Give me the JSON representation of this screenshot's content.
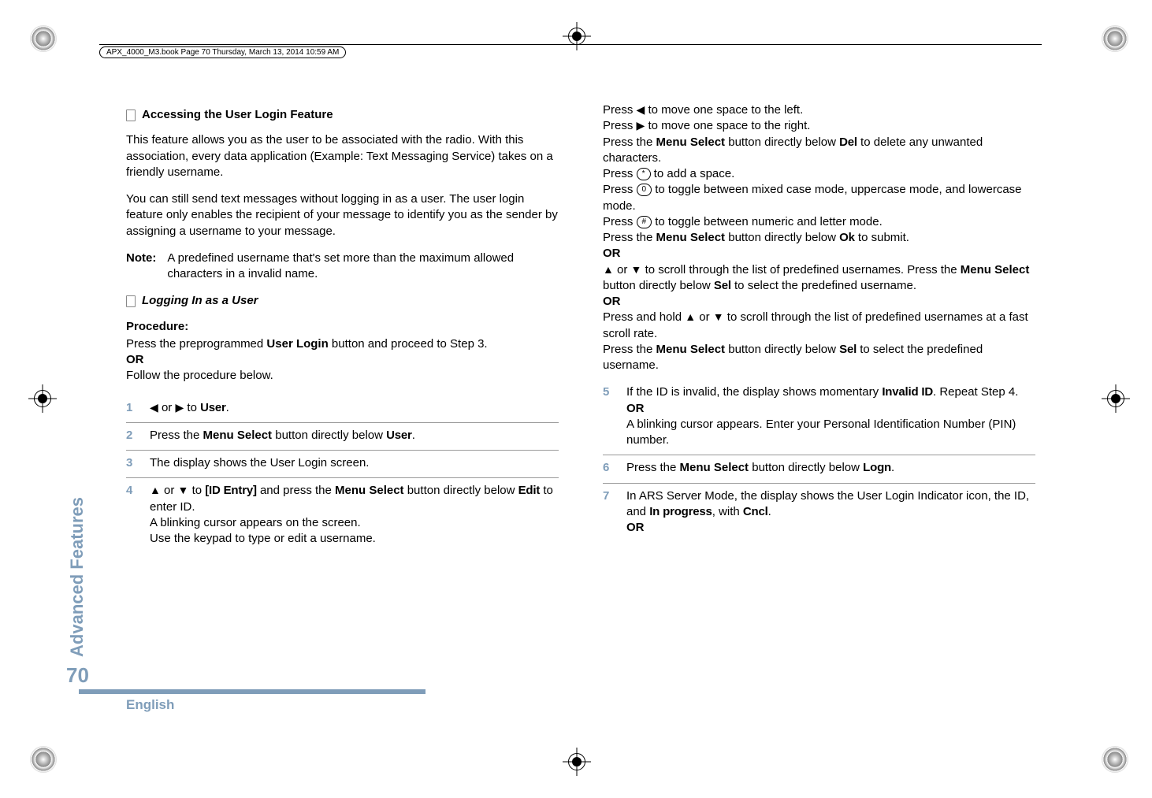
{
  "header": {
    "running": "APX_4000_M3.book  Page 70  Thursday, March 13, 2014  10:59 AM"
  },
  "sidebar": {
    "section": "Advanced Features",
    "page": "70"
  },
  "footer": {
    "language": "English"
  },
  "left": {
    "heading1": "Accessing the User Login Feature",
    "p1": "This feature allows you as the user to be associated with the radio. With this association, every data application (Example: Text Messaging Service) takes on a friendly username.",
    "p2": "You can still send text messages without logging in as a user. The user login feature only enables the recipient of your message to identify you as the sender by assigning a username to your message.",
    "note_label": "Note:",
    "note_body": "A predefined username that's set more than the maximum allowed characters in a invalid name.",
    "heading2": "Logging In as a User",
    "proc_label": "Procedure:",
    "proc_intro1a": "Press the preprogrammed ",
    "proc_intro1b": "User Login",
    "proc_intro1c": " button and proceed to Step 3.",
    "or": "OR",
    "proc_intro2": "Follow the procedure below.",
    "steps": {
      "s1": {
        "num": "1",
        "a": " or ",
        "b": " to ",
        "ui": "User",
        "c": "."
      },
      "s2": {
        "num": "2",
        "a": "Press the ",
        "b": "Menu Select",
        "c": " button directly below ",
        "ui": "User",
        "d": "."
      },
      "s3": {
        "num": "3",
        "a": "The display shows the User Login screen."
      },
      "s4": {
        "num": "4",
        "a": " or ",
        "b": " to ",
        "ui1": "[ID Entry]",
        "c": " and press the ",
        "d": "Menu Select",
        "e": " button directly below ",
        "ui2": "Edit",
        "f": " to enter ID.",
        "g": "A blinking cursor appears on the screen.",
        "h": "Use the keypad to type or edit a username."
      }
    }
  },
  "right": {
    "l1a": "Press ",
    "l1b": " to move one space to the left.",
    "l2a": "Press ",
    "l2b": " to move one space to the right.",
    "l3a": "Press the ",
    "l3b": "Menu Select",
    "l3c": " button directly below ",
    "l3ui": "Del",
    "l3d": " to delete any unwanted characters.",
    "l4a": "Press ",
    "l4key": "*",
    "l4b": " to add a space.",
    "l5a": "Press ",
    "l5key": "0",
    "l5b": " to toggle between mixed case mode, uppercase mode, and lowercase mode.",
    "l6a": "Press ",
    "l6key": "#",
    "l6b": " to toggle between numeric and letter mode.",
    "l7a": "Press the ",
    "l7b": "Menu Select",
    "l7c": " button directly below ",
    "l7ui": "Ok",
    "l7d": " to submit.",
    "or": "OR",
    "l8a": " or ",
    "l8b": " to scroll through the list of predefined usernames. Press the ",
    "l8c": "Menu Select",
    "l8d": " button directly below ",
    "l8ui": "Sel",
    "l8e": " to select the predefined username.",
    "l9a": "Press and hold ",
    "l9b": " or ",
    "l9c": " to scroll through the list of predefined usernames at a fast scroll rate.",
    "l10a": "Press the ",
    "l10b": "Menu Select",
    "l10c": " button directly below ",
    "l10ui": "Sel",
    "l10d": " to select the predefined username.",
    "steps": {
      "s5": {
        "num": "5",
        "a": "If the ID is invalid, the display shows momentary ",
        "ui": "Invalid ID",
        "b": ". Repeat Step 4.",
        "or": "OR",
        "c": "A blinking cursor appears. Enter your Personal Identification Number (PIN) number."
      },
      "s6": {
        "num": "6",
        "a": "Press the ",
        "b": "Menu Select",
        "c": " button directly below ",
        "ui": "Logn",
        "d": "."
      },
      "s7": {
        "num": "7",
        "a": "In ARS Server Mode, the display shows the User Login Indicator icon, the ID, and ",
        "ui1": "In progress",
        "b": ", with ",
        "ui2": "Cncl",
        "c": ".",
        "or": "OR"
      }
    }
  }
}
